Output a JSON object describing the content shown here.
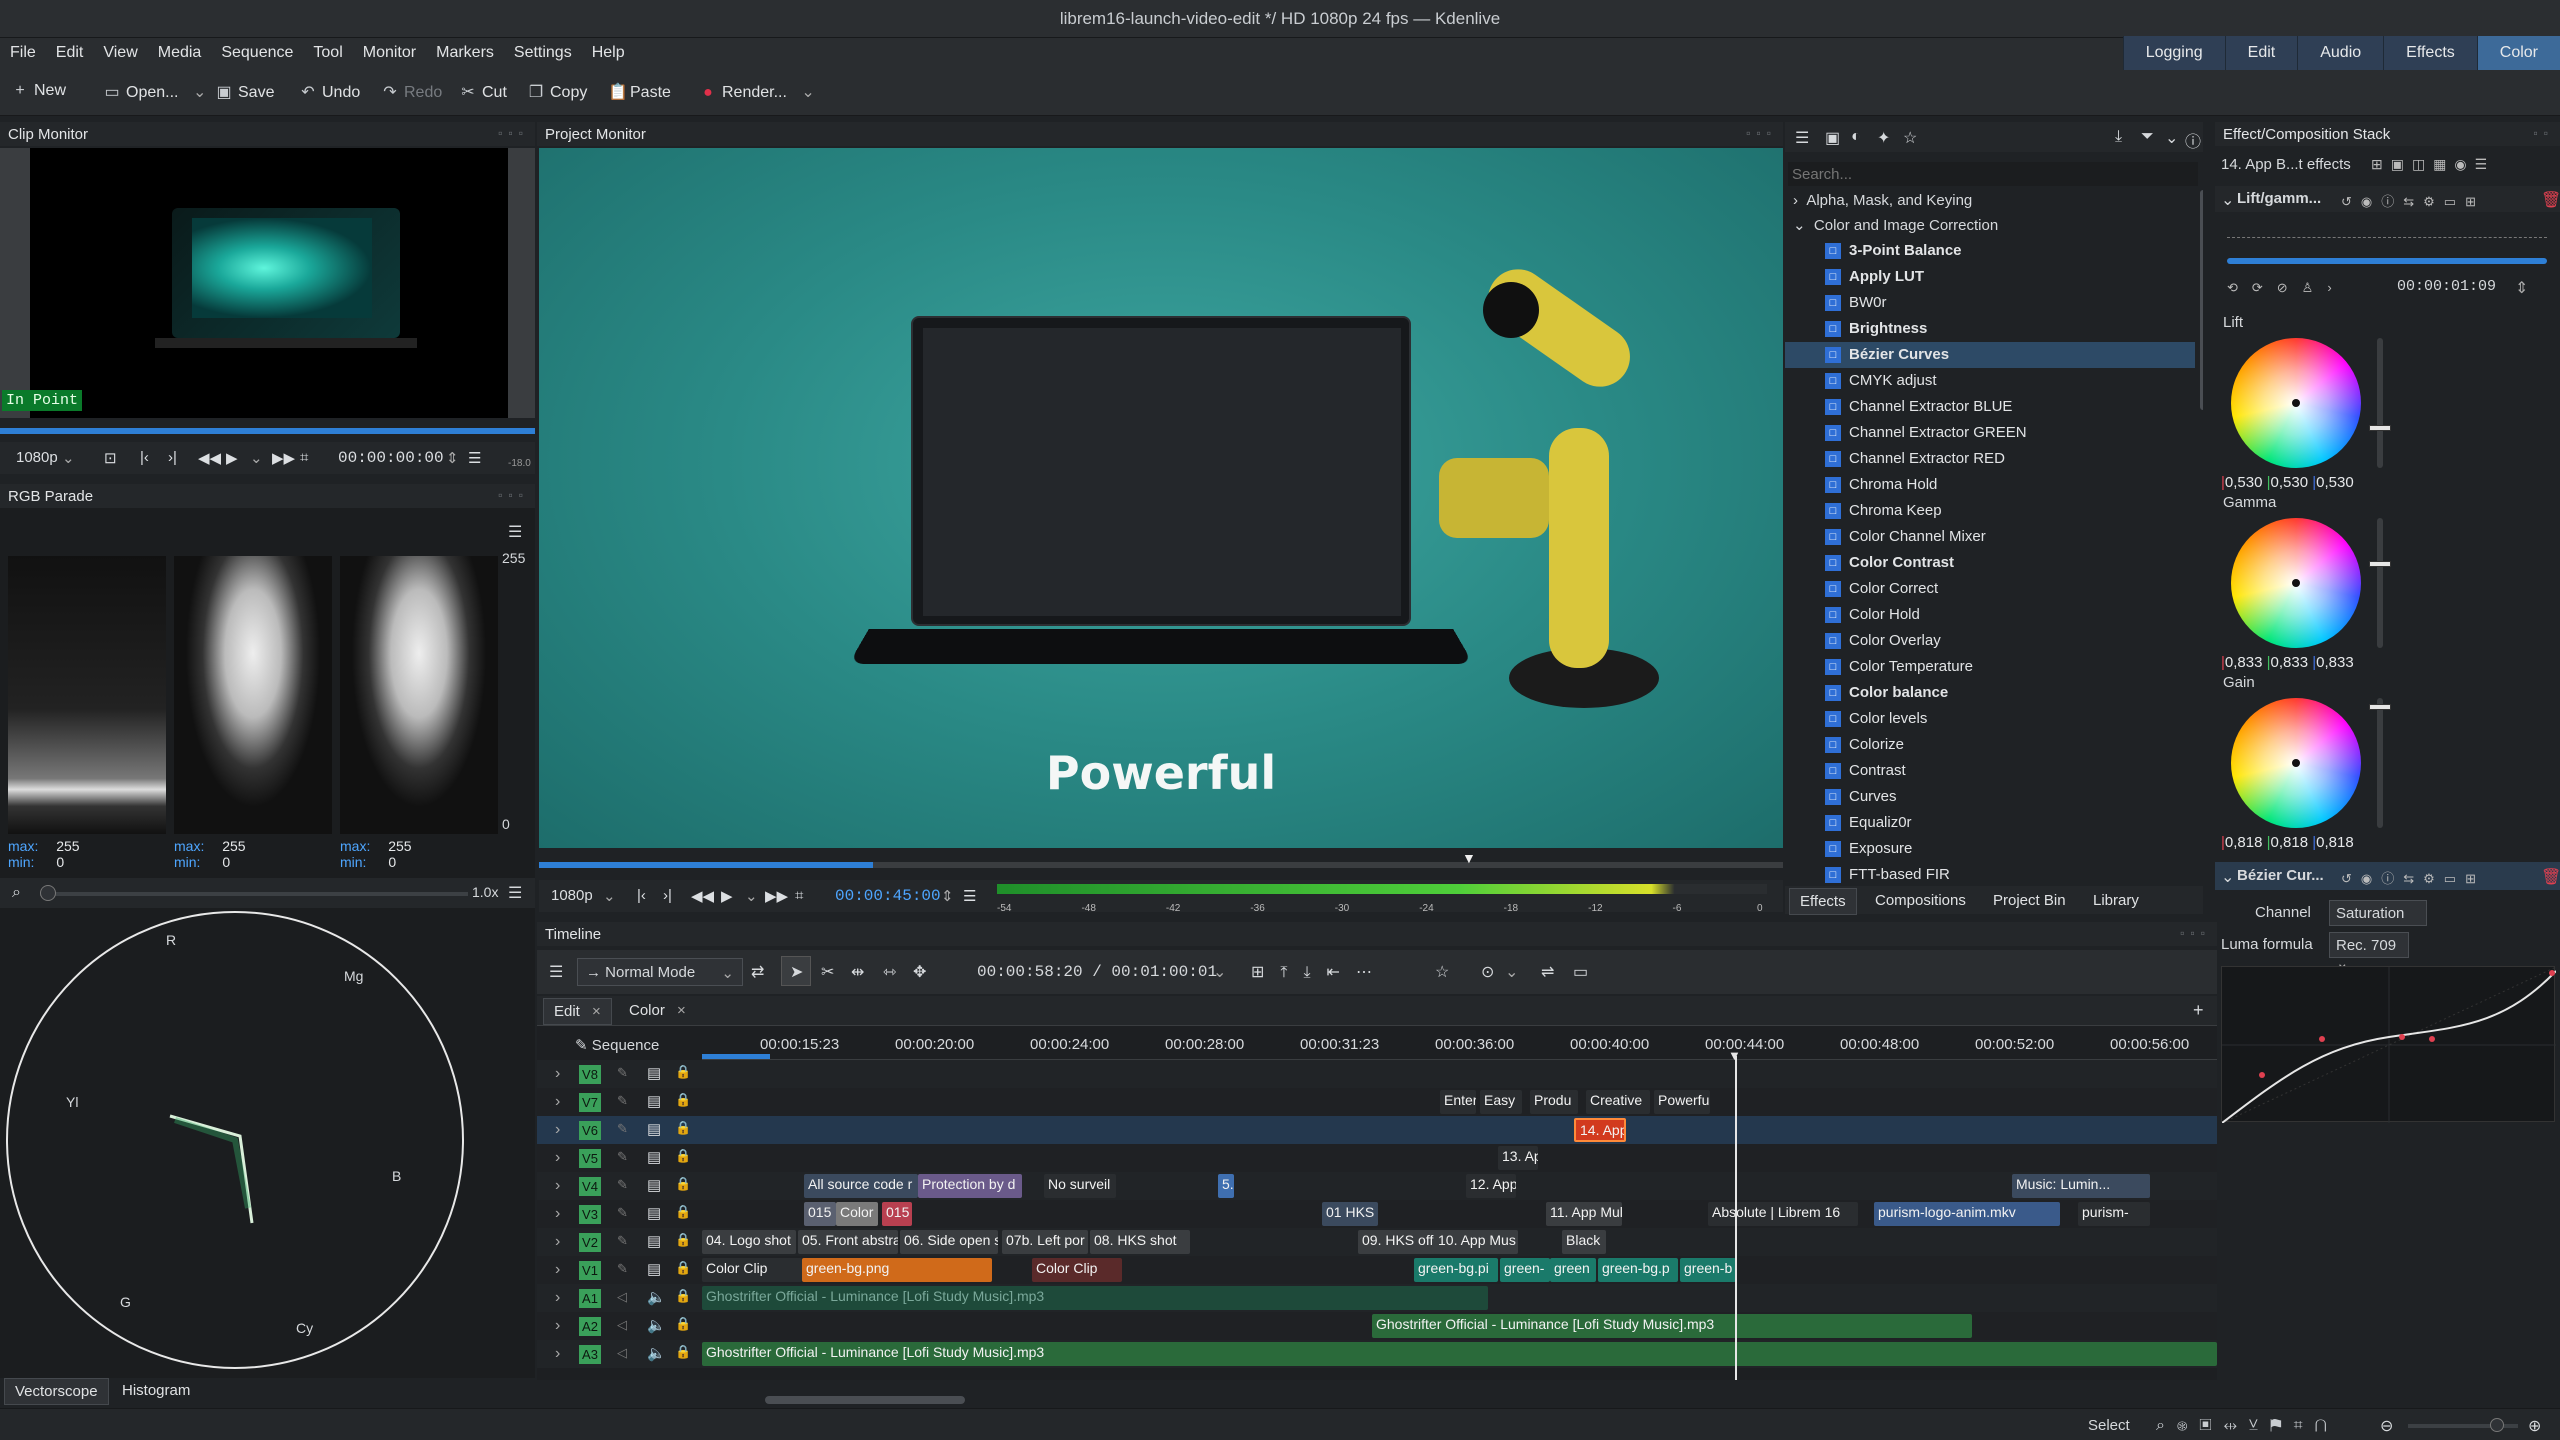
{
  "app": {
    "title": "librem16-launch-video-edit */ HD 1080p 24 fps — Kdenlive"
  },
  "menu": [
    "File",
    "Edit",
    "View",
    "Media",
    "Sequence",
    "Tool",
    "Monitor",
    "Markers",
    "Settings",
    "Help"
  ],
  "layouts": [
    "Logging",
    "Edit",
    "Audio",
    "Effects",
    "Color"
  ],
  "layout_active": "Color",
  "toolbar": {
    "new": "New",
    "open": "Open...",
    "save": "Save",
    "undo": "Undo",
    "redo": "Redo",
    "cut": "Cut",
    "copy": "Copy",
    "paste": "Paste",
    "render": "Render..."
  },
  "clip_monitor": {
    "title": "Clip Monitor",
    "in_point": "In Point",
    "res": "1080p",
    "timecode": "00:00:00:00",
    "vu_top": "-18.0"
  },
  "rgb_parade": {
    "title": "RGB Parade",
    "scale_top": "255",
    "scale_bottom": "0",
    "stats": [
      {
        "max_label": "max:",
        "max": "255",
        "min_label": "min:",
        "min": "0"
      },
      {
        "max_label": "max:",
        "max": "255",
        "min_label": "min:",
        "min": "0"
      },
      {
        "max_label": "max:",
        "max": "255",
        "min_label": "min:",
        "min": "0"
      }
    ],
    "zoom": "1.0x"
  },
  "vectorscope": {
    "labels": [
      "R",
      "Mg",
      "Yl",
      "B",
      "G",
      "Cy"
    ],
    "tabs": [
      "Vectorscope",
      "Histogram"
    ],
    "active_tab": "Vectorscope"
  },
  "project_monitor": {
    "title": "Project Monitor",
    "overlay_text": "Powerful",
    "res": "1080p",
    "timecode": "00:00:45:00",
    "meter_ticks": [
      "-54",
      "-48",
      "-42",
      "-36",
      "-30",
      "-24",
      "-18",
      "-12",
      "-6",
      "0"
    ]
  },
  "effects_panel": {
    "search_placeholder": "Search...",
    "cat1": "Alpha, Mask, and Keying",
    "cat2": "Color and Image Correction",
    "items": [
      {
        "n": "3-Point Balance",
        "b": true
      },
      {
        "n": "Apply LUT",
        "b": true
      },
      {
        "n": "BW0r",
        "b": false
      },
      {
        "n": "Brightness",
        "b": true
      },
      {
        "n": "Bézier Curves",
        "b": true,
        "sel": true
      },
      {
        "n": "CMYK adjust",
        "b": false
      },
      {
        "n": "Channel Extractor BLUE",
        "b": false
      },
      {
        "n": "Channel Extractor GREEN",
        "b": false
      },
      {
        "n": "Channel Extractor RED",
        "b": false
      },
      {
        "n": "Chroma Hold",
        "b": false
      },
      {
        "n": "Chroma Keep",
        "b": false
      },
      {
        "n": "Color Channel Mixer",
        "b": false
      },
      {
        "n": "Color Contrast",
        "b": true
      },
      {
        "n": "Color Correct",
        "b": false
      },
      {
        "n": "Color Hold",
        "b": false
      },
      {
        "n": "Color Overlay",
        "b": false
      },
      {
        "n": "Color Temperature",
        "b": false
      },
      {
        "n": "Color balance",
        "b": true
      },
      {
        "n": "Color levels",
        "b": false
      },
      {
        "n": "Colorize",
        "b": false
      },
      {
        "n": "Contrast",
        "b": false
      },
      {
        "n": "Curves",
        "b": false
      },
      {
        "n": "Equaliz0r",
        "b": false
      },
      {
        "n": "Exposure",
        "b": false
      },
      {
        "n": "FTT-based FIR",
        "b": false
      }
    ],
    "tabs": [
      "Effects",
      "Compositions",
      "Project Bin",
      "Library"
    ],
    "active_tab": "Effects"
  },
  "stack": {
    "title": "Effect/Composition Stack",
    "clip": "14. App B...t effects",
    "effect1": "Lift/gamm...",
    "tc": "00:00:01:09",
    "lift": {
      "label": "Lift",
      "r": "0,530",
      "g": "0,530",
      "b": "0,530",
      "level": 0.7
    },
    "gamma": {
      "label": "Gamma",
      "r": "0,833",
      "g": "0,833",
      "b": "0,833",
      "level": 0.35
    },
    "gain": {
      "label": "Gain",
      "r": "0,818",
      "g": "0,818",
      "b": "0,818",
      "level": 0.05
    },
    "effect2": "Bézier Cur...",
    "channel_label": "Channel",
    "channel": "Saturation",
    "luma_label": "Luma formula",
    "luma": "Rec. 709"
  },
  "timeline": {
    "title": "Timeline",
    "mode": "Normal Mode",
    "tc": "00:00:58:20 / 00:01:00:01",
    "tabs": [
      "Edit",
      "Color"
    ],
    "sequence": "Sequence",
    "ruler": [
      "00:00:15:23",
      "00:00:20:00",
      "00:00:24:00",
      "00:00:28:00",
      "00:00:31:23",
      "00:00:36:00",
      "00:00:40:00",
      "00:00:44:00",
      "00:00:48:00",
      "00:00:52:00",
      "00:00:56:00"
    ],
    "tracks": [
      "V8",
      "V7",
      "V6",
      "V5",
      "V4",
      "V3",
      "V2",
      "V1",
      "A1",
      "A2",
      "A3"
    ]
  },
  "clips": {
    "v7": [
      "Enter",
      "Easy",
      "Produ",
      "Creative",
      "Powerfu"
    ],
    "v6": "14. App",
    "v5": "13. Ap",
    "v4": [
      "All source code r",
      "Protection by d",
      "No surveil",
      "5.",
      "12. App",
      "Music: Lumin..."
    ],
    "v3": [
      "015",
      "Color C",
      "015",
      "01 HKS",
      "11. App Mul",
      "Absolute | Librem 16",
      "purism-logo-anim.mkv",
      "purism-"
    ],
    "v2": [
      "04. Logo shot",
      "05. Front abstrac",
      "06. Side open s",
      "07b. Left por",
      "08. HKS shot",
      "09. HKS off s",
      "10. App Mus",
      "Black"
    ],
    "v1": [
      "Color Clip",
      "green-bg.png",
      "Color Clip",
      "green-bg.pi",
      "green-",
      "green",
      "green-bg.p",
      "green-b"
    ],
    "a1": "Ghostrifter Official - Luminance [Lofi Study Music].mp3",
    "a2": "Ghostrifter Official - Luminance [Lofi Study Music].mp3",
    "a3": "Ghostrifter Official - Luminance [Lofi Study Music].mp3"
  },
  "status": {
    "mode": "Select"
  }
}
